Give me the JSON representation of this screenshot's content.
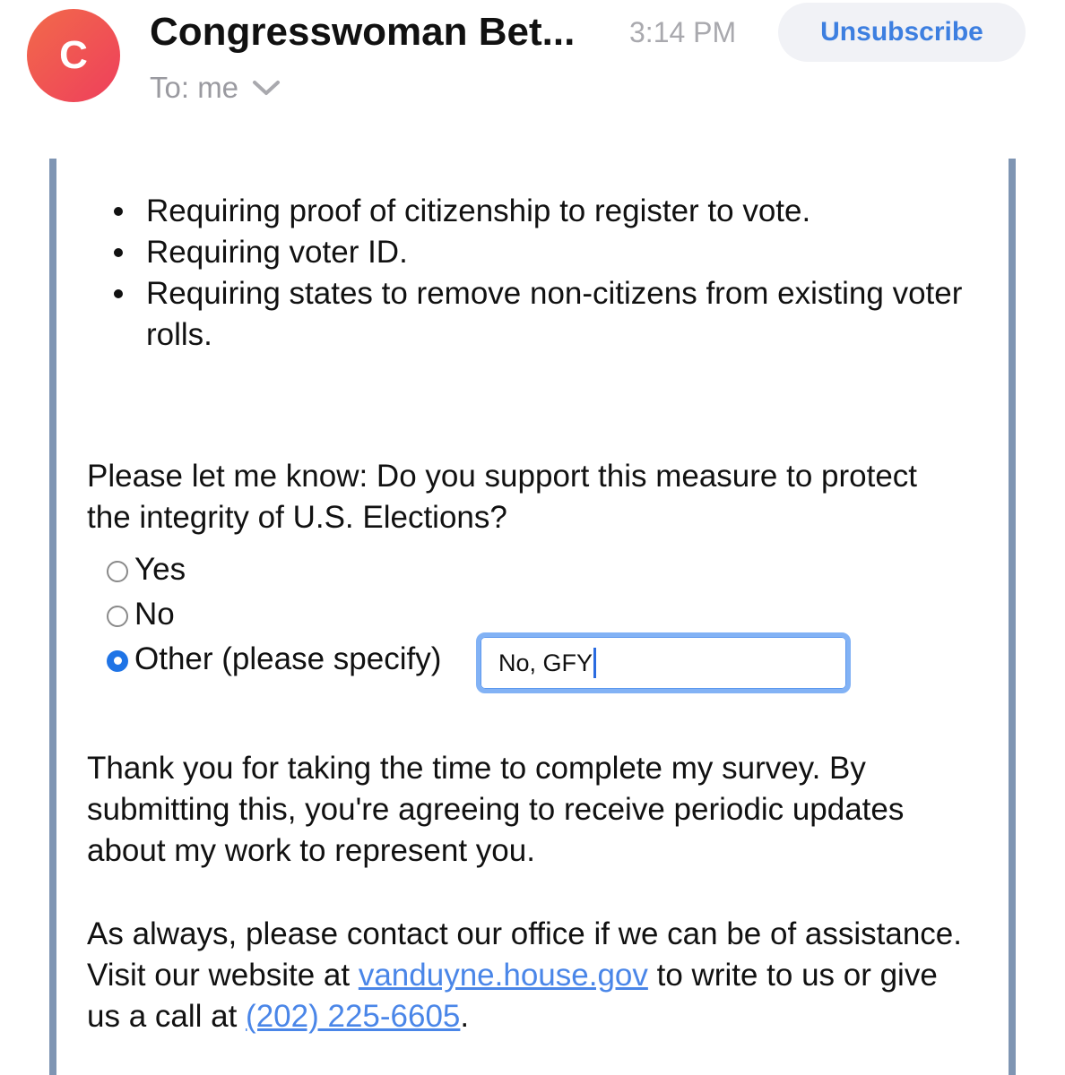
{
  "header": {
    "avatar_initial": "C",
    "sender": "Congresswoman Bet...",
    "time": "3:14 PM",
    "unsubscribe_label": "Unsubscribe",
    "to_label": "To: me",
    "chevron_icon": "chevron-down-icon",
    "avatar_color": "#ee4a58",
    "accent_color": "#3d7fe0"
  },
  "email": {
    "bullets": [
      "Requiring proof of citizenship to register to vote.",
      "Requiring voter ID.",
      "Requiring states to remove non-citizens from existing voter rolls."
    ],
    "question": "Please let me know: Do you support this measure to protect the integrity of U.S. Elections?",
    "options": [
      {
        "label": "Yes",
        "selected": false
      },
      {
        "label": "No",
        "selected": false
      },
      {
        "label": "Other (please specify)",
        "selected": true
      }
    ],
    "other_input_value": "No, GFY",
    "para1": "Thank you for taking the time to complete my survey. By submitting this, you're agreeing to receive periodic updates about my work to represent you.",
    "para2": {
      "before_link": "As always, please contact our office if we can be of assistance. Visit our website at ",
      "website_link": "vanduyne.house.gov",
      "middle": " to write to us or give us a call at ",
      "phone_link": "(202) 225-6605",
      "after": "."
    },
    "link_color": "#4a86e8",
    "frame_color": "#7f95b3"
  }
}
